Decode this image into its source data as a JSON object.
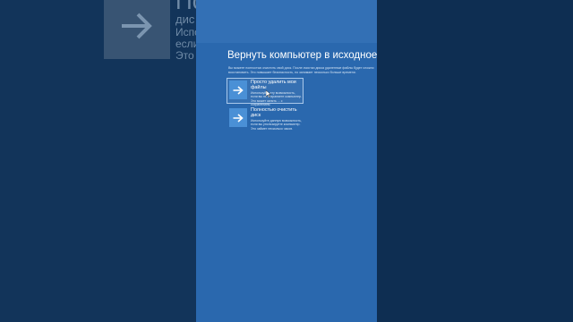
{
  "background": {
    "title": "Пол",
    "subtitle": "дис",
    "text": "Испо\nесли\nЭто з"
  },
  "reset": {
    "title": "Вернуть компьютер в исходное с",
    "description": "Вы можете полностью очистить свой диск. После очистки диска удаленные файлы будет сложно восстановить. Это повышает безопасность, но занимает несколько больше времени.",
    "options": [
      {
        "title": "Просто удалить мои файлы",
        "text": "Используйте эту возможность, если вы не сохраняете компьютер. Это может занять ... с сохранением.",
        "icon": "arrow-right-icon",
        "selected": true
      },
      {
        "title": "Полностью очистить диск",
        "text": "Используйте данную возможность, если вы утилизируете компьютер. Это займет несколько часов.",
        "icon": "arrow-right-icon",
        "selected": false
      }
    ]
  },
  "colors": {
    "panel": "#2a68ae",
    "backdrop": "#0e2e52",
    "tile": "#4a90d6"
  }
}
